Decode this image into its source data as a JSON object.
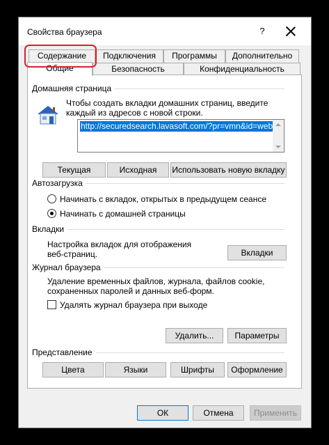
{
  "window": {
    "title": "Свойства браузера",
    "help": "?"
  },
  "tabs_row1": [
    "Содержание",
    "Подключения",
    "Программы",
    "Дополнительно"
  ],
  "tabs_row2": [
    "Общие",
    "Безопасность",
    "Конфиденциальность"
  ],
  "home": {
    "label": "Домашняя страница",
    "hint": "Чтобы создать вкладки домашних страниц, введите каждый из адресов с новой строки.",
    "url": "http://securedsearch.lavasoft.com/?pr=vmn&id=web",
    "btn_current": "Текущая",
    "btn_default": "Исходная",
    "btn_newtab": "Использовать новую вкладку"
  },
  "startup": {
    "label": "Автозагрузка",
    "opt1": "Начинать с вкладок, открытых в предыдущем сеансе",
    "opt2": "Начинать с домашней страницы",
    "selected": "opt2"
  },
  "tabs_group": {
    "label": "Вкладки",
    "desc": "Настройка вкладок для отображения веб-страниц.",
    "btn": "Вкладки"
  },
  "history": {
    "label": "Журнал браузера",
    "desc": "Удаление временных файлов, журнала, файлов cookie, сохраненных паролей и данных веб-форм.",
    "checkbox": "Удалять журнал браузера при выходе",
    "checked": false,
    "btn_delete": "Удалить...",
    "btn_settings": "Параметры"
  },
  "appearance": {
    "label": "Представление",
    "btn_colors": "Цвета",
    "btn_langs": "Языки",
    "btn_fonts": "Шрифты",
    "btn_access": "Оформление"
  },
  "footer": {
    "ok": "ОК",
    "cancel": "Отмена",
    "apply": "Применить"
  },
  "colors": {
    "highlight": "#d3212d",
    "selection": "#0078d7"
  }
}
